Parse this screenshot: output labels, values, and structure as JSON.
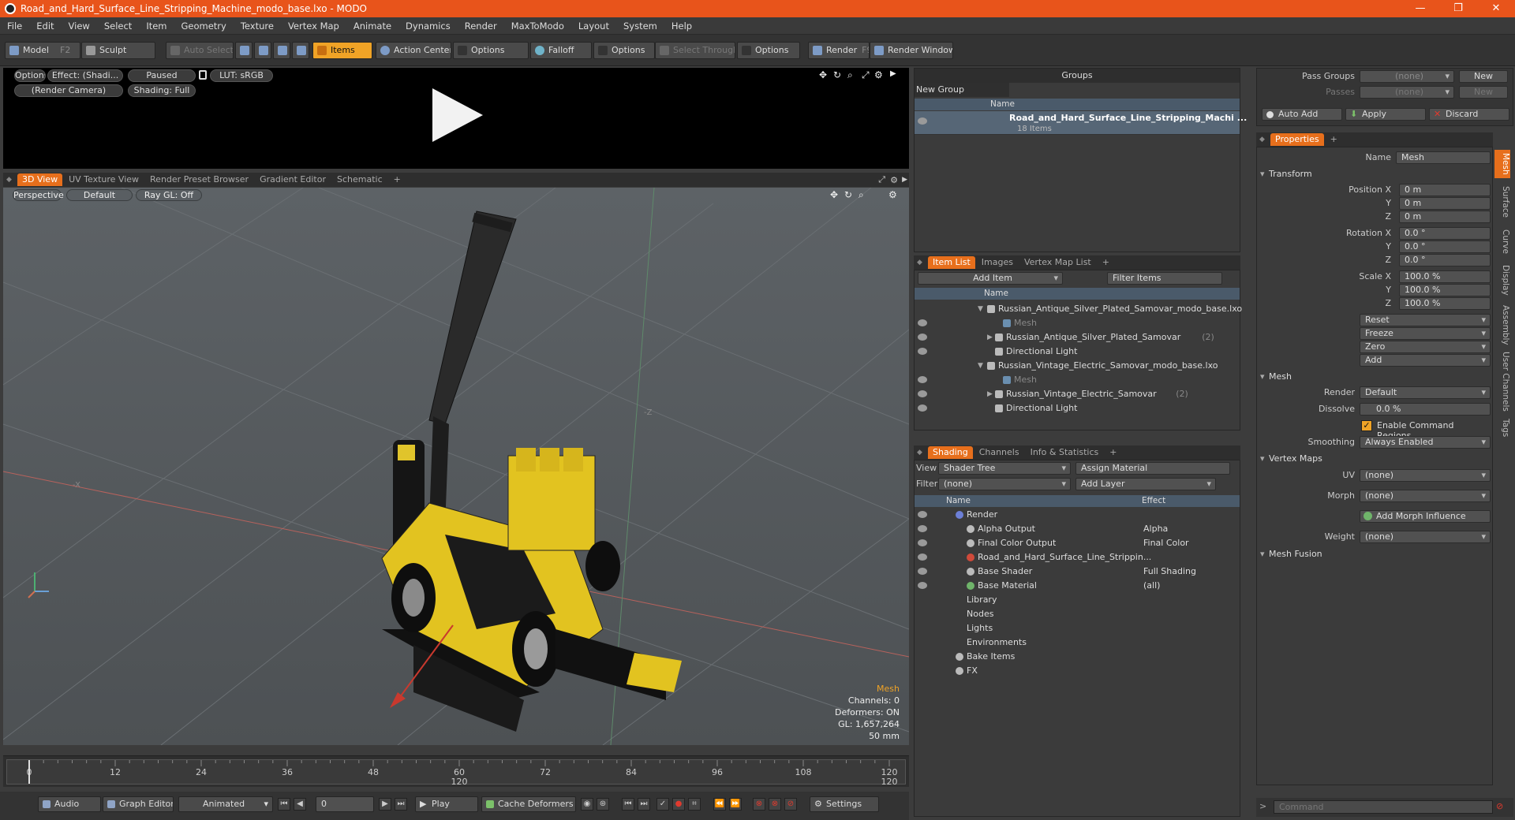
{
  "window": {
    "title": "Road_and_Hard_Surface_Line_Stripping_Machine_modo_base.lxo - MODO",
    "controls": [
      "—",
      "❐",
      "✕"
    ]
  },
  "menu": [
    "File",
    "Edit",
    "View",
    "Select",
    "Item",
    "Geometry",
    "Texture",
    "Vertex Map",
    "Animate",
    "Dynamics",
    "Render",
    "MaxToModo",
    "Layout",
    "System",
    "Help"
  ],
  "toolbar": {
    "model": "Model",
    "model_key": "F2",
    "sculpt": "Sculpt",
    "auto_select": "Auto Select",
    "items": "Items",
    "action_center": "Action Center",
    "options1": "Options",
    "falloff": "Falloff",
    "options2": "Options",
    "select_through": "Select Through",
    "options3": "Options",
    "render": "Render",
    "render_key": "F9",
    "render_window": "Render Window"
  },
  "preview": {
    "options": "Options",
    "effect": "Effect: (Shadi...",
    "paused": "Paused",
    "lut": "LUT: sRGB",
    "camera": "(Render Camera)",
    "shading": "Shading: Full"
  },
  "view_tabs": [
    "3D View",
    "UV Texture View",
    "Render Preset Browser",
    "Gradient Editor",
    "Schematic",
    "+"
  ],
  "viewport": {
    "perspective": "Perspective",
    "default": "Default",
    "raygl": "Ray GL: Off",
    "axis_x": "-X",
    "axis_z": "-Z",
    "info_title": "Mesh",
    "channels": "Channels: 0",
    "deformers": "Deformers: ON",
    "gl": "GL: 1,657,264",
    "size": "50 mm"
  },
  "timeline": {
    "ticks": [
      "0",
      "12",
      "24",
      "36",
      "48",
      "60",
      "72",
      "84",
      "96",
      "108",
      "120"
    ],
    "mid_label": "120",
    "end_label": "120"
  },
  "bottombar": {
    "audio": "Audio",
    "graph_editor": "Graph Editor",
    "animated": "Animated",
    "frame": "0",
    "play": "Play",
    "cache_deformers": "Cache Deformers",
    "settings": "Settings"
  },
  "groups": {
    "title": "Groups",
    "new_group": "New Group",
    "col_name": "Name",
    "item_name": "Road_and_Hard_Surface_Line_Stripping_Machi ...",
    "item_count": "18 Items"
  },
  "itemlist": {
    "tabs": [
      "Item List",
      "Images",
      "Vertex Map List",
      "+"
    ],
    "add_item": "Add Item",
    "filter_items": "Filter Items",
    "col_name": "Name",
    "rows": [
      {
        "label": "Russian_Antique_Silver_Plated_Samovar_modo_base.lxo",
        "indent": 0,
        "dim": false
      },
      {
        "label": "Mesh",
        "indent": 2,
        "dim": true
      },
      {
        "label": "Russian_Antique_Silver_Plated_Samovar",
        "suffix": "(2)",
        "indent": 1,
        "dim": false
      },
      {
        "label": "Directional Light",
        "indent": 1,
        "dim": false
      },
      {
        "label": "Russian_Vintage_Electric_Samovar_modo_base.lxo",
        "indent": 0,
        "dim": false
      },
      {
        "label": "Mesh",
        "indent": 2,
        "dim": true
      },
      {
        "label": "Russian_Vintage_Electric_Samovar",
        "suffix": "(2)",
        "indent": 1,
        "dim": false
      },
      {
        "label": "Directional Light",
        "indent": 1,
        "dim": false
      }
    ]
  },
  "shading": {
    "tabs": [
      "Shading",
      "Channels",
      "Info & Statistics",
      "+"
    ],
    "view_label": "View",
    "view_value": "Shader Tree",
    "assign_material": "Assign Material",
    "filter_label": "Filter",
    "filter_value": "(none)",
    "add_layer": "Add Layer",
    "col_name": "Name",
    "col_effect": "Effect",
    "rows": [
      {
        "label": "Render",
        "effect": "",
        "indent": 0
      },
      {
        "label": "Alpha Output",
        "effect": "Alpha",
        "indent": 1
      },
      {
        "label": "Final Color Output",
        "effect": "Final Color",
        "indent": 1
      },
      {
        "label": "Road_and_Hard_Surface_Line_Strippin...",
        "effect": "",
        "indent": 1
      },
      {
        "label": "Base Shader",
        "effect": "Full Shading",
        "indent": 1
      },
      {
        "label": "Base Material",
        "effect": "(all)",
        "indent": 1
      },
      {
        "label": "Library",
        "effect": "",
        "indent": 0
      },
      {
        "label": "Nodes",
        "effect": "",
        "indent": 0
      },
      {
        "label": "Lights",
        "effect": "",
        "indent": 0
      },
      {
        "label": "Environments",
        "effect": "",
        "indent": 0
      },
      {
        "label": "Bake Items",
        "effect": "",
        "indent": 0
      },
      {
        "label": "FX",
        "effect": "",
        "indent": 0
      }
    ]
  },
  "passes": {
    "pass_groups_label": "Pass Groups",
    "pass_groups_value": "(none)",
    "passes_label": "Passes",
    "passes_value": "(none)",
    "new1": "New",
    "new2": "New",
    "auto_add": "Auto Add",
    "apply": "Apply",
    "discard": "Discard"
  },
  "properties": {
    "tab": "Properties",
    "name_label": "Name",
    "name_value": "Mesh",
    "transform": "Transform",
    "position_x_label": "Position X",
    "position_x": "0 m",
    "position_y_label": "Y",
    "position_y": "0 m",
    "position_z_label": "Z",
    "position_z": "0 m",
    "rotation_x_label": "Rotation X",
    "rotation_x": "0.0 °",
    "rotation_y_label": "Y",
    "rotation_y": "0.0 °",
    "rotation_z_label": "Z",
    "rotation_z": "0.0 °",
    "scale_x_label": "Scale X",
    "scale_x": "100.0 %",
    "scale_y_label": "Y",
    "scale_y": "100.0 %",
    "scale_z_label": "Z",
    "scale_z": "100.0 %",
    "reset": "Reset",
    "freeze": "Freeze",
    "zero": "Zero",
    "add": "Add",
    "mesh": "Mesh",
    "render_label": "Render",
    "render_value": "Default",
    "dissolve_label": "Dissolve",
    "dissolve_value": "0.0 %",
    "enable_command_regions": "Enable Command Regions",
    "smoothing_label": "Smoothing",
    "smoothing_value": "Always Enabled",
    "vertex_maps": "Vertex Maps",
    "uv_label": "UV",
    "uv_value": "(none)",
    "morph_label": "Morph",
    "morph_value": "(none)",
    "add_morph_influence": "Add Morph Influence",
    "weight_label": "Weight",
    "weight_value": "(none)",
    "mesh_fusion": "Mesh Fusion",
    "side_tabs": [
      "Mesh",
      "Surface",
      "Curve",
      "Display",
      "Assembly",
      "User Channels",
      "Tags"
    ]
  },
  "command": {
    "placeholder": "Command"
  },
  "colors": {
    "titlebar": "#e8541b",
    "accent": "#f0a326",
    "tab_active": "#e76f1c"
  }
}
